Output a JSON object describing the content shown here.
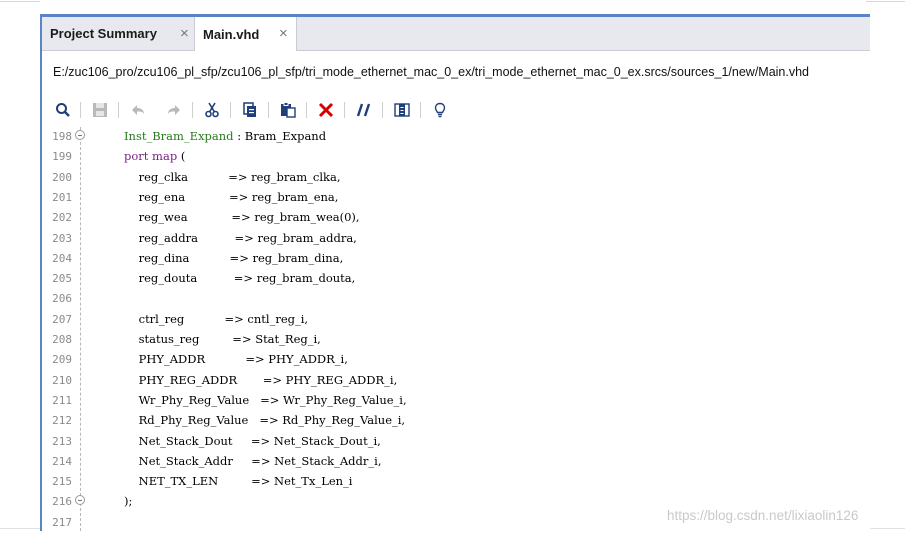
{
  "tabs": [
    {
      "label": "Project Summary",
      "active": false
    },
    {
      "label": "Main.vhd",
      "active": true
    }
  ],
  "tab_close_glyph": "×",
  "file_path": "E:/zuc106_pro/zcu106_pl_sfp/zcu106_pl_sfp/tri_mode_ethernet_mac_0_ex/tri_mode_ethernet_mac_0_ex.srcs/sources_1/new/Main.vhd",
  "toolbar_icons": [
    "search-icon",
    "save-icon",
    "undo-icon",
    "redo-icon",
    "cut-icon",
    "copy-icon",
    "paste-icon",
    "delete-icon",
    "comment-icon",
    "columns-icon",
    "lightbulb-icon"
  ],
  "code_lines": [
    {
      "num": "198",
      "fold": true,
      "indent": "",
      "a": "Inst_Bram_Expand",
      "b": " : ",
      "c": "Bram_Expand"
    },
    {
      "num": "199",
      "fold": false,
      "indent": "",
      "a": "port map",
      "b": " (",
      "c": ""
    },
    {
      "num": "200",
      "fold": false,
      "indent": "    ",
      "a": "reg_clka",
      "b": "           => ",
      "c": "reg_bram_clka,"
    },
    {
      "num": "201",
      "fold": false,
      "indent": "    ",
      "a": "reg_ena",
      "b": "            => ",
      "c": "reg_bram_ena,"
    },
    {
      "num": "202",
      "fold": false,
      "indent": "    ",
      "a": "reg_wea",
      "b": "            => ",
      "c": "reg_bram_wea(0),"
    },
    {
      "num": "203",
      "fold": false,
      "indent": "    ",
      "a": "reg_addra",
      "b": "          => ",
      "c": "reg_bram_addra,"
    },
    {
      "num": "204",
      "fold": false,
      "indent": "    ",
      "a": "reg_dina",
      "b": "           => ",
      "c": "reg_bram_dina,"
    },
    {
      "num": "205",
      "fold": false,
      "indent": "    ",
      "a": "reg_douta",
      "b": "          => ",
      "c": "reg_bram_douta,"
    },
    {
      "num": "206",
      "fold": false,
      "indent": "",
      "a": "",
      "b": "",
      "c": ""
    },
    {
      "num": "207",
      "fold": false,
      "indent": "    ",
      "a": "ctrl_reg",
      "b": "           => ",
      "c": "cntl_reg_i,"
    },
    {
      "num": "208",
      "fold": false,
      "indent": "    ",
      "a": "status_reg",
      "b": "         => ",
      "c": "Stat_Reg_i,"
    },
    {
      "num": "209",
      "fold": false,
      "indent": "    ",
      "a": "PHY_ADDR",
      "b": "           => ",
      "c": "PHY_ADDR_i,"
    },
    {
      "num": "210",
      "fold": false,
      "indent": "    ",
      "a": "PHY_REG_ADDR",
      "b": "       => ",
      "c": "PHY_REG_ADDR_i,"
    },
    {
      "num": "211",
      "fold": false,
      "indent": "    ",
      "a": "Wr_Phy_Reg_Value",
      "b": "   => ",
      "c": "Wr_Phy_Reg_Value_i,"
    },
    {
      "num": "212",
      "fold": false,
      "indent": "    ",
      "a": "Rd_Phy_Reg_Value",
      "b": "   => ",
      "c": "Rd_Phy_Reg_Value_i,"
    },
    {
      "num": "213",
      "fold": false,
      "indent": "    ",
      "a": "Net_Stack_Dout",
      "b": "     => ",
      "c": "Net_Stack_Dout_i,"
    },
    {
      "num": "214",
      "fold": false,
      "indent": "    ",
      "a": "Net_Stack_Addr",
      "b": "     => ",
      "c": "Net_Stack_Addr_i,"
    },
    {
      "num": "215",
      "fold": false,
      "indent": "    ",
      "a": "NET_TX_LEN",
      "b": "         => ",
      "c": "Net_Tx_Len_i"
    },
    {
      "num": "216",
      "fold": true,
      "indent": "",
      "a": ");",
      "b": "",
      "c": ""
    },
    {
      "num": "217",
      "fold": false,
      "indent": "",
      "a": "",
      "b": "",
      "c": ""
    }
  ],
  "watermark": "https://blog.csdn.net/lixiaolin126",
  "colors": {
    "accent": "#5b84c8",
    "instance": "#2a7a1f",
    "keyword": "#7a1f8a",
    "delete": "#d40000"
  }
}
